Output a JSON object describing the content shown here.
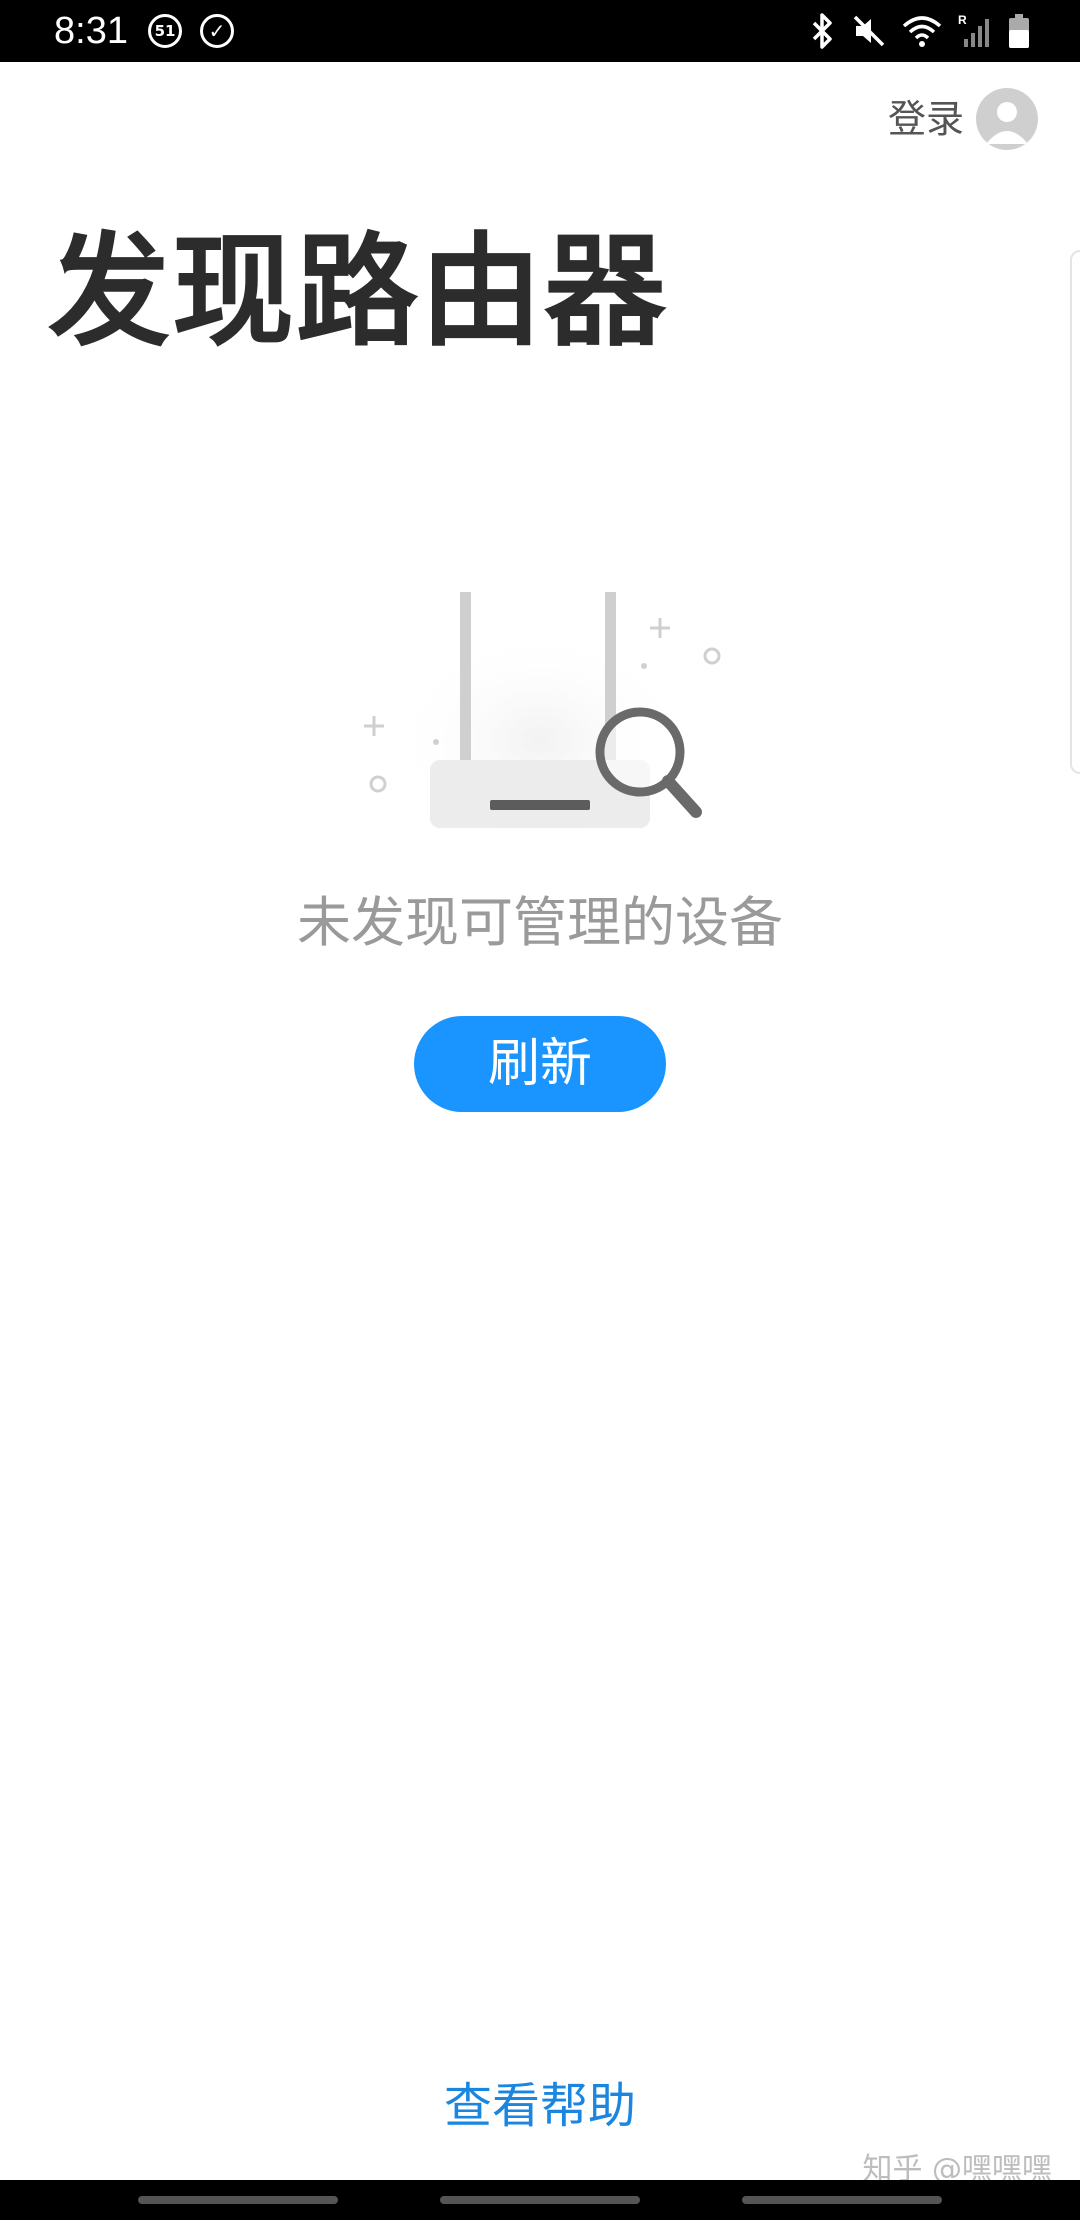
{
  "status_bar": {
    "time": "8:31",
    "notification_badge": "51",
    "icons": [
      "bluetooth-icon",
      "mute-icon",
      "wifi-icon",
      "signal-icon",
      "battery-icon"
    ]
  },
  "header": {
    "login_label": "登录",
    "avatar_icon": "user-avatar-icon"
  },
  "page": {
    "title": "发现路由器"
  },
  "empty_state": {
    "illustration_icon": "router-search-icon",
    "message": "未发现可管理的设备",
    "refresh_label": "刷新"
  },
  "footer": {
    "help_label": "查看帮助",
    "watermark": "知乎 @嘿嘿嘿"
  },
  "colors": {
    "accent": "#1a95ff",
    "link": "#1a86e0",
    "title": "#2c2c2c",
    "muted_text": "#9a9a9a"
  }
}
